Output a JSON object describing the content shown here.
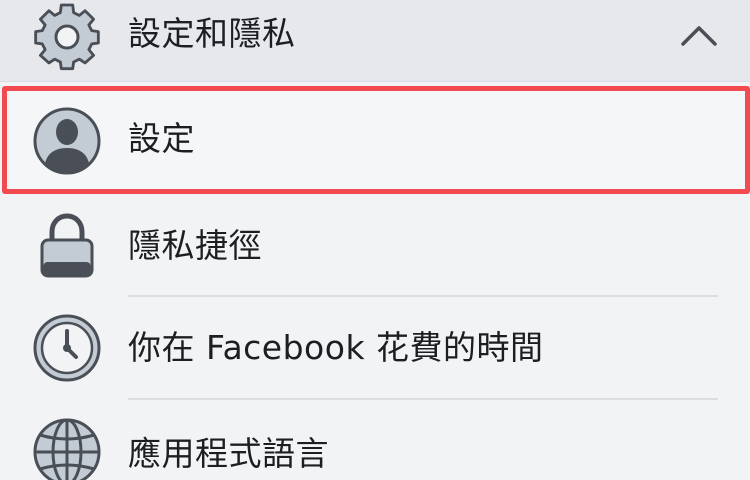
{
  "menu": {
    "section_title": "設定和隱私",
    "items": [
      {
        "label": "設定",
        "icon": "user-profile-icon"
      },
      {
        "label": "隱私捷徑",
        "icon": "lock-icon"
      },
      {
        "label": "你在 Facebook 花費的時間",
        "icon": "clock-icon"
      },
      {
        "label": "應用程式語言",
        "icon": "globe-icon"
      }
    ]
  },
  "colors": {
    "highlight": "#f24b4f",
    "icon_fill": "#c3ccd5",
    "icon_stroke": "#4a4f57",
    "header_bg": "#e7e8ec"
  }
}
